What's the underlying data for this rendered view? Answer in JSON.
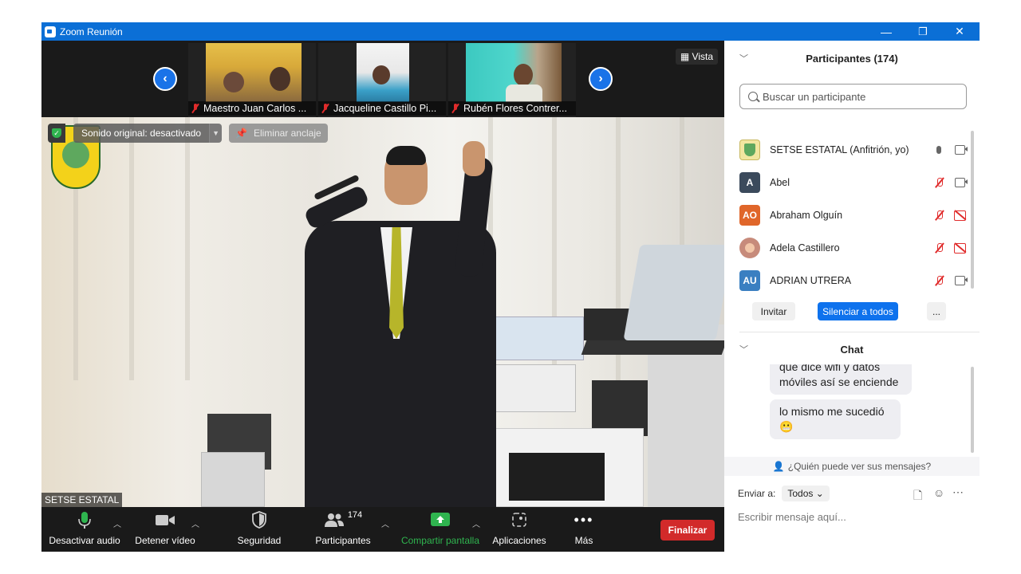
{
  "window": {
    "title": "Zoom Reunión",
    "minimize": "—",
    "restore": "❐",
    "close": "✕"
  },
  "strip": {
    "prev": "‹",
    "next": "›",
    "view_label": "Vista",
    "thumbs": [
      {
        "name": "Maestro Juan Carlos ..."
      },
      {
        "name": "Jacqueline Castillo Pi..."
      },
      {
        "name": "Rubén Flores Contrer..."
      }
    ]
  },
  "main": {
    "sound_label": "Sonido original: desactivado",
    "unpin_label": "Eliminar anclaje",
    "speaker_name": "SETSE ESTATAL"
  },
  "toolbar": {
    "mute": "Desactivar audio",
    "video": "Detener vídeo",
    "security": "Seguridad",
    "participants": "Participantes",
    "participants_count": "174",
    "share": "Compartir pantalla",
    "apps": "Aplicaciones",
    "more": "Más",
    "end": "Finalizar"
  },
  "panel": {
    "participants_header": "Participantes (174)",
    "search_placeholder": "Buscar un participante",
    "participants": [
      {
        "name": "SETSE ESTATAL (Anfitrión, yo)",
        "initials": "",
        "color": "#f1e6a0"
      },
      {
        "name": "Abel",
        "initials": "A",
        "color": "#3b4a5c"
      },
      {
        "name": "Abraham Olguín",
        "initials": "AO",
        "color": "#e0662a"
      },
      {
        "name": "Adela Castillero",
        "initials": "",
        "color": "#c78b7b"
      },
      {
        "name": "ADRIAN UTRERA",
        "initials": "AU",
        "color": "#3a7fc1"
      }
    ],
    "invite": "Invitar",
    "mute_all": "Silenciar a todos",
    "more": "...",
    "chat_header": "Chat",
    "messages": [
      "que dice wifi y datos móviles así se enciende",
      "lo mismo me sucedió 😬"
    ],
    "who_can_see": "¿Quién puede ver sus mensajes?",
    "send_to_label": "Enviar a:",
    "send_to_value": "Todos",
    "message_placeholder": "Escribir mensaje aquí..."
  }
}
